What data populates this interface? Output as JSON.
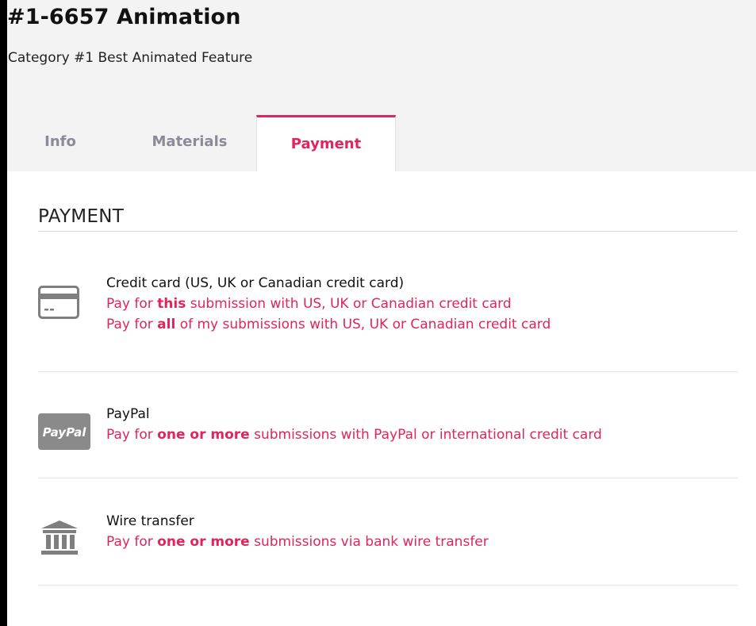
{
  "header": {
    "title": "#1-6657 Animation",
    "subtitle": "Category #1 Best Animated Feature"
  },
  "tabs": [
    {
      "label": "Info",
      "active": false
    },
    {
      "label": "Materials",
      "active": false
    },
    {
      "label": "Payment",
      "active": true
    }
  ],
  "section": {
    "heading": "PAYMENT"
  },
  "methods": {
    "credit_card": {
      "icon": "credit-card-icon",
      "title": "Credit card (US, UK or Canadian credit card)",
      "links": [
        {
          "prefix": "Pay for ",
          "emphasis": "this",
          "suffix": " submission with US, UK or Canadian credit card"
        },
        {
          "prefix": "Pay for ",
          "emphasis": "all",
          "suffix": " of my submissions with US, UK or Canadian credit card"
        }
      ]
    },
    "paypal": {
      "icon": "paypal-icon",
      "icon_text": "PayPal",
      "title": "PayPal",
      "links": [
        {
          "prefix": "Pay for ",
          "emphasis": "one or more",
          "suffix": " submissions with PayPal or international credit card"
        }
      ]
    },
    "wire": {
      "icon": "bank-icon",
      "title": "Wire transfer",
      "links": [
        {
          "prefix": "Pay for ",
          "emphasis": "one or more",
          "suffix": " submissions via bank wire transfer"
        }
      ]
    }
  },
  "colors": {
    "accent": "#e0245e",
    "icon": "#7f7f7f",
    "background": "#f3f3f3",
    "panel": "#ffffff"
  }
}
